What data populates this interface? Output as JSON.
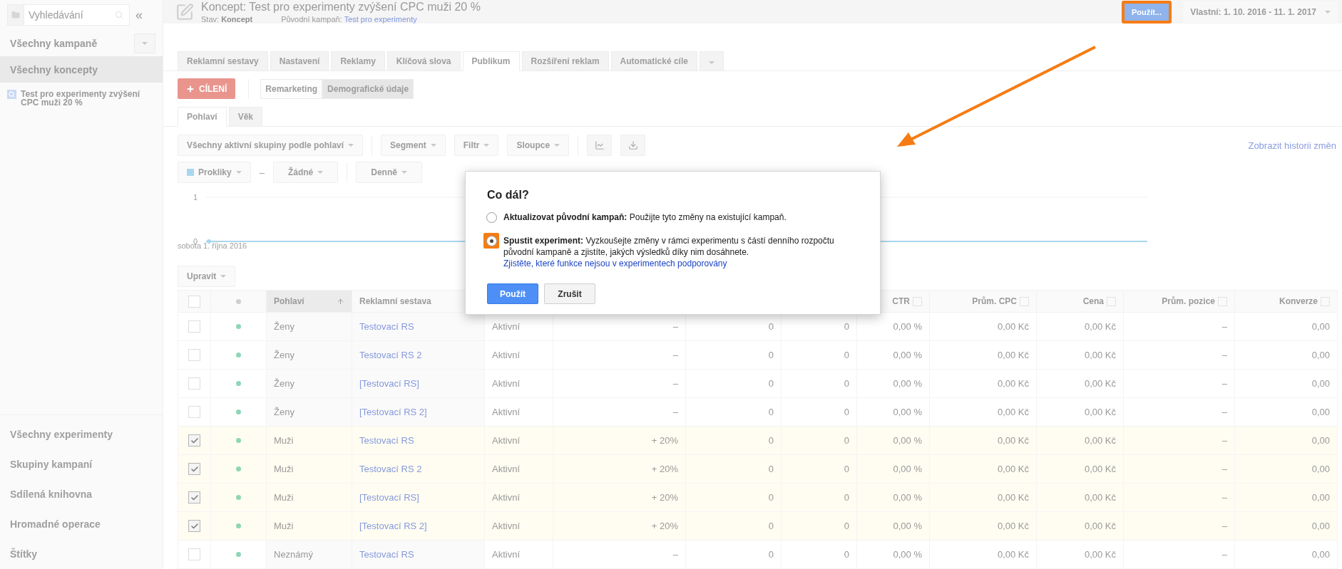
{
  "sidebar": {
    "search": {
      "placeholder": "Vyhledávání"
    },
    "collapse": "«",
    "nav_top": [
      {
        "label": "Všechny kampaně",
        "kind": "dropdown",
        "selected": false
      },
      {
        "label": "Všechny koncepty",
        "kind": "plain",
        "selected": true
      }
    ],
    "tree": [
      {
        "label": "Test pro experimenty zvýšení CPC muži 20 %"
      }
    ],
    "nav_bottom": [
      "Všechny experimenty",
      "Skupiny kampaní",
      "Sdílená knihovna",
      "Hromadné operace",
      "Štítky"
    ]
  },
  "header": {
    "title": "Koncept: Test pro experimenty zvýšení CPC muži 20 %",
    "status_label": "Stav:",
    "status": "Koncept",
    "origin_label": "Původní kampaň:",
    "origin": "Test pro experimenty",
    "apply_button": {
      "label": "Použít...",
      "highlighted": true
    },
    "date_range": "Vlastní: 1. 10. 2016 - 11. 1. 2017"
  },
  "tabs": [
    {
      "label": "Reklamní sestavy",
      "selected": false
    },
    {
      "label": "Nastavení",
      "selected": false
    },
    {
      "label": "Reklamy",
      "selected": false
    },
    {
      "label": "Klíčová slova",
      "selected": false
    },
    {
      "label": "Publikum",
      "selected": true
    },
    {
      "label": "Rozšíření reklam",
      "selected": false
    },
    {
      "label": "Automatické cíle",
      "selected": false
    }
  ],
  "targeting_button": "CÍLENÍ",
  "subtabs": [
    {
      "label": "Remarketing",
      "selected": false
    },
    {
      "label": "Demografické údaje",
      "selected": true
    }
  ],
  "gender_tabs": [
    {
      "label": "Pohlaví",
      "selected": true
    },
    {
      "label": "Věk",
      "selected": false
    }
  ],
  "toolbar": {
    "filters": [
      "Všechny aktivní skupiny podle pohlaví",
      "Segment",
      "Filtr",
      "Sloupce"
    ],
    "history_link": "Zobrazit historii změn"
  },
  "chart_controls": {
    "separator": "–",
    "metric2": "Žádné",
    "period": "Denně"
  },
  "chart_data": {
    "type": "line",
    "x": [
      "sobota 1. října 2016"
    ],
    "ylim": [
      0,
      1
    ],
    "yticks": [
      0,
      1
    ],
    "series": [
      {
        "name": "Prokliky",
        "color": "#a9d6ef",
        "marker": "circle",
        "values": [
          0
        ]
      }
    ]
  },
  "edit_button": "Upravit",
  "table": {
    "select_all": {
      "checked": false
    },
    "columns": [
      {
        "kind": "text",
        "label": "Pohlaví",
        "sorted": true
      },
      {
        "kind": "text",
        "label": "Reklamní sestava"
      },
      {
        "kind": "covered"
      },
      {
        "kind": "covered"
      },
      {
        "kind": "covered"
      },
      {
        "kind": "covered"
      },
      {
        "kind": "metric",
        "label": "CTR"
      },
      {
        "kind": "metric",
        "label": "Prům. CPC"
      },
      {
        "kind": "metric",
        "label": "Cena"
      },
      {
        "kind": "metric",
        "label": "Prům. pozice"
      },
      {
        "kind": "metric",
        "label": "Konverze"
      }
    ],
    "rows": [
      {
        "checked": false,
        "cells": [
          "Ženy",
          "Testovací RS",
          "Aktivní",
          "–",
          "0",
          "0",
          "0,00 %",
          "0,00 Kč",
          "0,00 Kč",
          "–",
          "0,00"
        ]
      },
      {
        "checked": false,
        "cells": [
          "Ženy",
          "Testovací RS 2",
          "Aktivní",
          "–",
          "0",
          "0",
          "0,00 %",
          "0,00 Kč",
          "0,00 Kč",
          "–",
          "0,00"
        ]
      },
      {
        "checked": false,
        "cells": [
          "Ženy",
          "[Testovací RS]",
          "Aktivní",
          "–",
          "0",
          "0",
          "0,00 %",
          "0,00 Kč",
          "0,00 Kč",
          "–",
          "0,00"
        ]
      },
      {
        "checked": false,
        "cells": [
          "Ženy",
          "[Testovací RS 2]",
          "Aktivní",
          "–",
          "0",
          "0",
          "0,00 %",
          "0,00 Kč",
          "0,00 Kč",
          "–",
          "0,00"
        ]
      },
      {
        "checked": true,
        "cells": [
          "Muži",
          "Testovací RS",
          "Aktivní",
          "+ 20%",
          "0",
          "0",
          "0,00 %",
          "0,00 Kč",
          "0,00 Kč",
          "–",
          "0,00"
        ]
      },
      {
        "checked": true,
        "cells": [
          "Muži",
          "Testovací RS 2",
          "Aktivní",
          "+ 20%",
          "0",
          "0",
          "0,00 %",
          "0,00 Kč",
          "0,00 Kč",
          "–",
          "0,00"
        ]
      },
      {
        "checked": true,
        "cells": [
          "Muži",
          "[Testovací RS]",
          "Aktivní",
          "+ 20%",
          "0",
          "0",
          "0,00 %",
          "0,00 Kč",
          "0,00 Kč",
          "–",
          "0,00"
        ]
      },
      {
        "checked": true,
        "cells": [
          "Muži",
          "[Testovací RS 2]",
          "Aktivní",
          "+ 20%",
          "0",
          "0",
          "0,00 %",
          "0,00 Kč",
          "0,00 Kč",
          "–",
          "0,00"
        ]
      },
      {
        "checked": false,
        "cells": [
          "Neznámý",
          "Testovací RS",
          "Aktivní",
          "–",
          "0",
          "0",
          "0,00 %",
          "0,00 Kč",
          "0,00 Kč",
          "–",
          "0,00"
        ]
      }
    ]
  },
  "dialog": {
    "title": "Co dál?",
    "options": [
      {
        "title": "Aktualizovat původní kampaň:",
        "text": "Použijte tyto změny na existující kampaň.",
        "selected": false,
        "highlighted": false
      },
      {
        "title": "Spustit experiment:",
        "text": "Vyzkoušejte změny v rámci experimentu s částí denního rozpočtu původní kampaně a zjistíte, jakých výsledků díky nim dosáhnete.",
        "link": "Zjistěte, které funkce nejsou v experimentech podporovány",
        "selected": true,
        "highlighted": true
      }
    ],
    "buttons": [
      {
        "label": "Použít",
        "kind": "primary"
      },
      {
        "label": "Zrušit",
        "kind": "secondary"
      }
    ]
  }
}
